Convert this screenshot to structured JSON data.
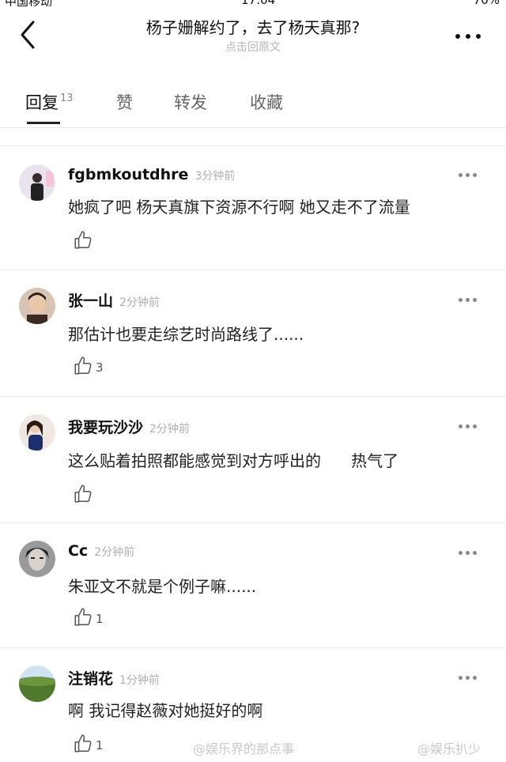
{
  "statusbar": {
    "carrier": "中国移动",
    "time": "17:04",
    "battery": "70%"
  },
  "header": {
    "title": "杨子姗解约了，去了杨天真那?",
    "subtitle": "点击回原文",
    "back_icon": "chevron-left-icon",
    "more_icon": "more-horizontal-icon"
  },
  "tabs": [
    {
      "label": "回复",
      "count": "13"
    },
    {
      "label": "赞"
    },
    {
      "label": "转发"
    },
    {
      "label": "收藏"
    }
  ],
  "comments": [
    {
      "user": "fgbmkoutdhre",
      "time": "3分钟前",
      "text": "她疯了吧 杨天真旗下资源不行啊 她又走不了流量",
      "likes": ""
    },
    {
      "user": "张一山",
      "time": "2分钟前",
      "text": "那估计也要走综艺时尚路线了......",
      "likes": "3"
    },
    {
      "user": "我要玩沙沙",
      "time": "2分钟前",
      "text": "这么贴着拍照都能感觉到对方呼出的      热气了",
      "likes": ""
    },
    {
      "user": "Cc",
      "time": "2分钟前",
      "text": "朱亚文不就是个例子嘛......",
      "likes": "1"
    },
    {
      "user": "注销花",
      "time": "1分钟前",
      "text": "啊 我记得赵薇对她挺好的啊",
      "likes": "1"
    }
  ],
  "watermarks": [
    "@娱乐界的那点事",
    "@娱乐扒少"
  ]
}
